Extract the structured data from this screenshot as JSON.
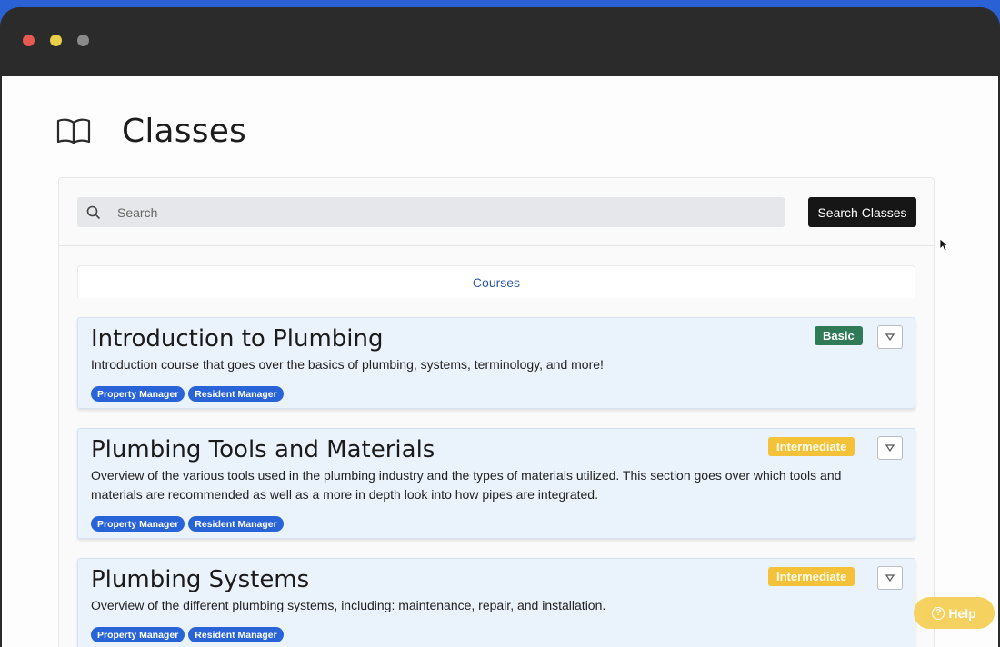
{
  "window": {
    "controls": [
      "close",
      "minimize",
      "zoom"
    ]
  },
  "header": {
    "icon": "book-icon",
    "title": "Classes"
  },
  "search": {
    "icon": "search-icon",
    "placeholder": "Search",
    "value": "",
    "button_label": "Search Classes"
  },
  "tabs": {
    "active": "Courses"
  },
  "courses": [
    {
      "title": "Introduction to Plumbing",
      "description": "Introduction course that goes over the basics of plumbing, systems, terminology, and more!",
      "level": "Basic",
      "tags": [
        "Property Manager",
        "Resident Manager"
      ]
    },
    {
      "title": "Plumbing Tools and Materials",
      "description": "Overview of the various tools used in the plumbing industry and the types of materials utilized. This section goes over which tools and materials are recommended as well as a more in depth look into how pipes are integrated.",
      "level": "Intermediate",
      "tags": [
        "Property Manager",
        "Resident Manager"
      ]
    },
    {
      "title": "Plumbing Systems",
      "description": "Overview of the different plumbing systems, including: maintenance, repair, and installation.",
      "level": "Intermediate",
      "tags": [
        "Property Manager",
        "Resident Manager"
      ]
    }
  ],
  "help": {
    "label": "Help",
    "icon": "question-circle-icon"
  },
  "colors": {
    "basic": "#2f7a57",
    "intermediate": "#f3c239",
    "tag": "#2864d8",
    "help": "#f5cf52",
    "search_button": "#161616"
  }
}
